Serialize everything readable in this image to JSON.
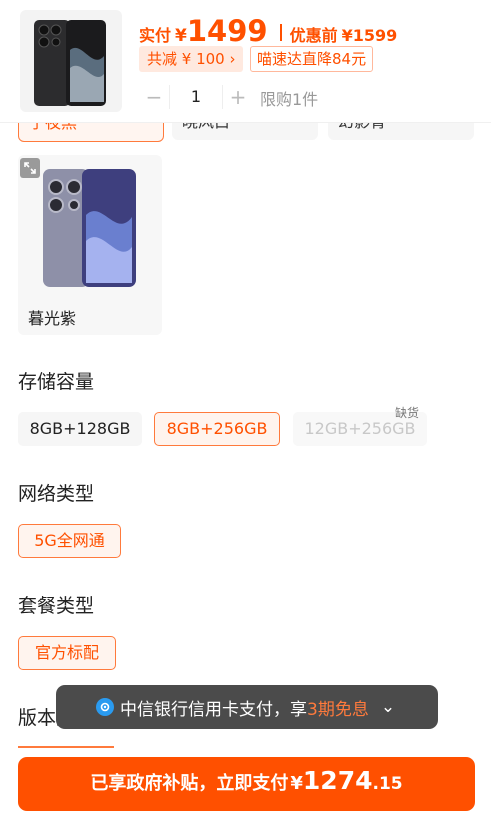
{
  "header": {
    "price_label": "实付",
    "currency": "¥",
    "price": "1499",
    "before_label": "优惠前",
    "before_price": "¥1599",
    "discount_chip": "共减 ¥ 100 ›",
    "delivery_chip": "喵速达直降84元",
    "quantity": "1",
    "minus": "−",
    "plus": "+",
    "limit": "限购1件"
  },
  "color": {
    "peek_items": [
      "子夜黑",
      "晓风白",
      "幻影青"
    ],
    "card_label": "暮光紫"
  },
  "storage": {
    "title": "存储容量",
    "options": [
      "8GB+128GB",
      "8GB+256GB",
      "12GB+256GB"
    ],
    "stock_tag": "缺货"
  },
  "network": {
    "title": "网络类型",
    "options": [
      "5G全网通"
    ]
  },
  "package": {
    "title": "套餐类型",
    "options": [
      "官方标配"
    ]
  },
  "version": {
    "title": "版本类型"
  },
  "toast": {
    "prefix": "中信银行信用卡支付，享",
    "highlight": "3期免息",
    "chevron": "⌄"
  },
  "pay": {
    "text": "已享政府补贴，立即支付",
    "currency": "¥",
    "integer": "1274",
    "decimal": ".15"
  },
  "colors": {
    "accent": "#ff5000",
    "accent_light": "#fff4ee",
    "toast_bg": "#4b4b4b"
  }
}
